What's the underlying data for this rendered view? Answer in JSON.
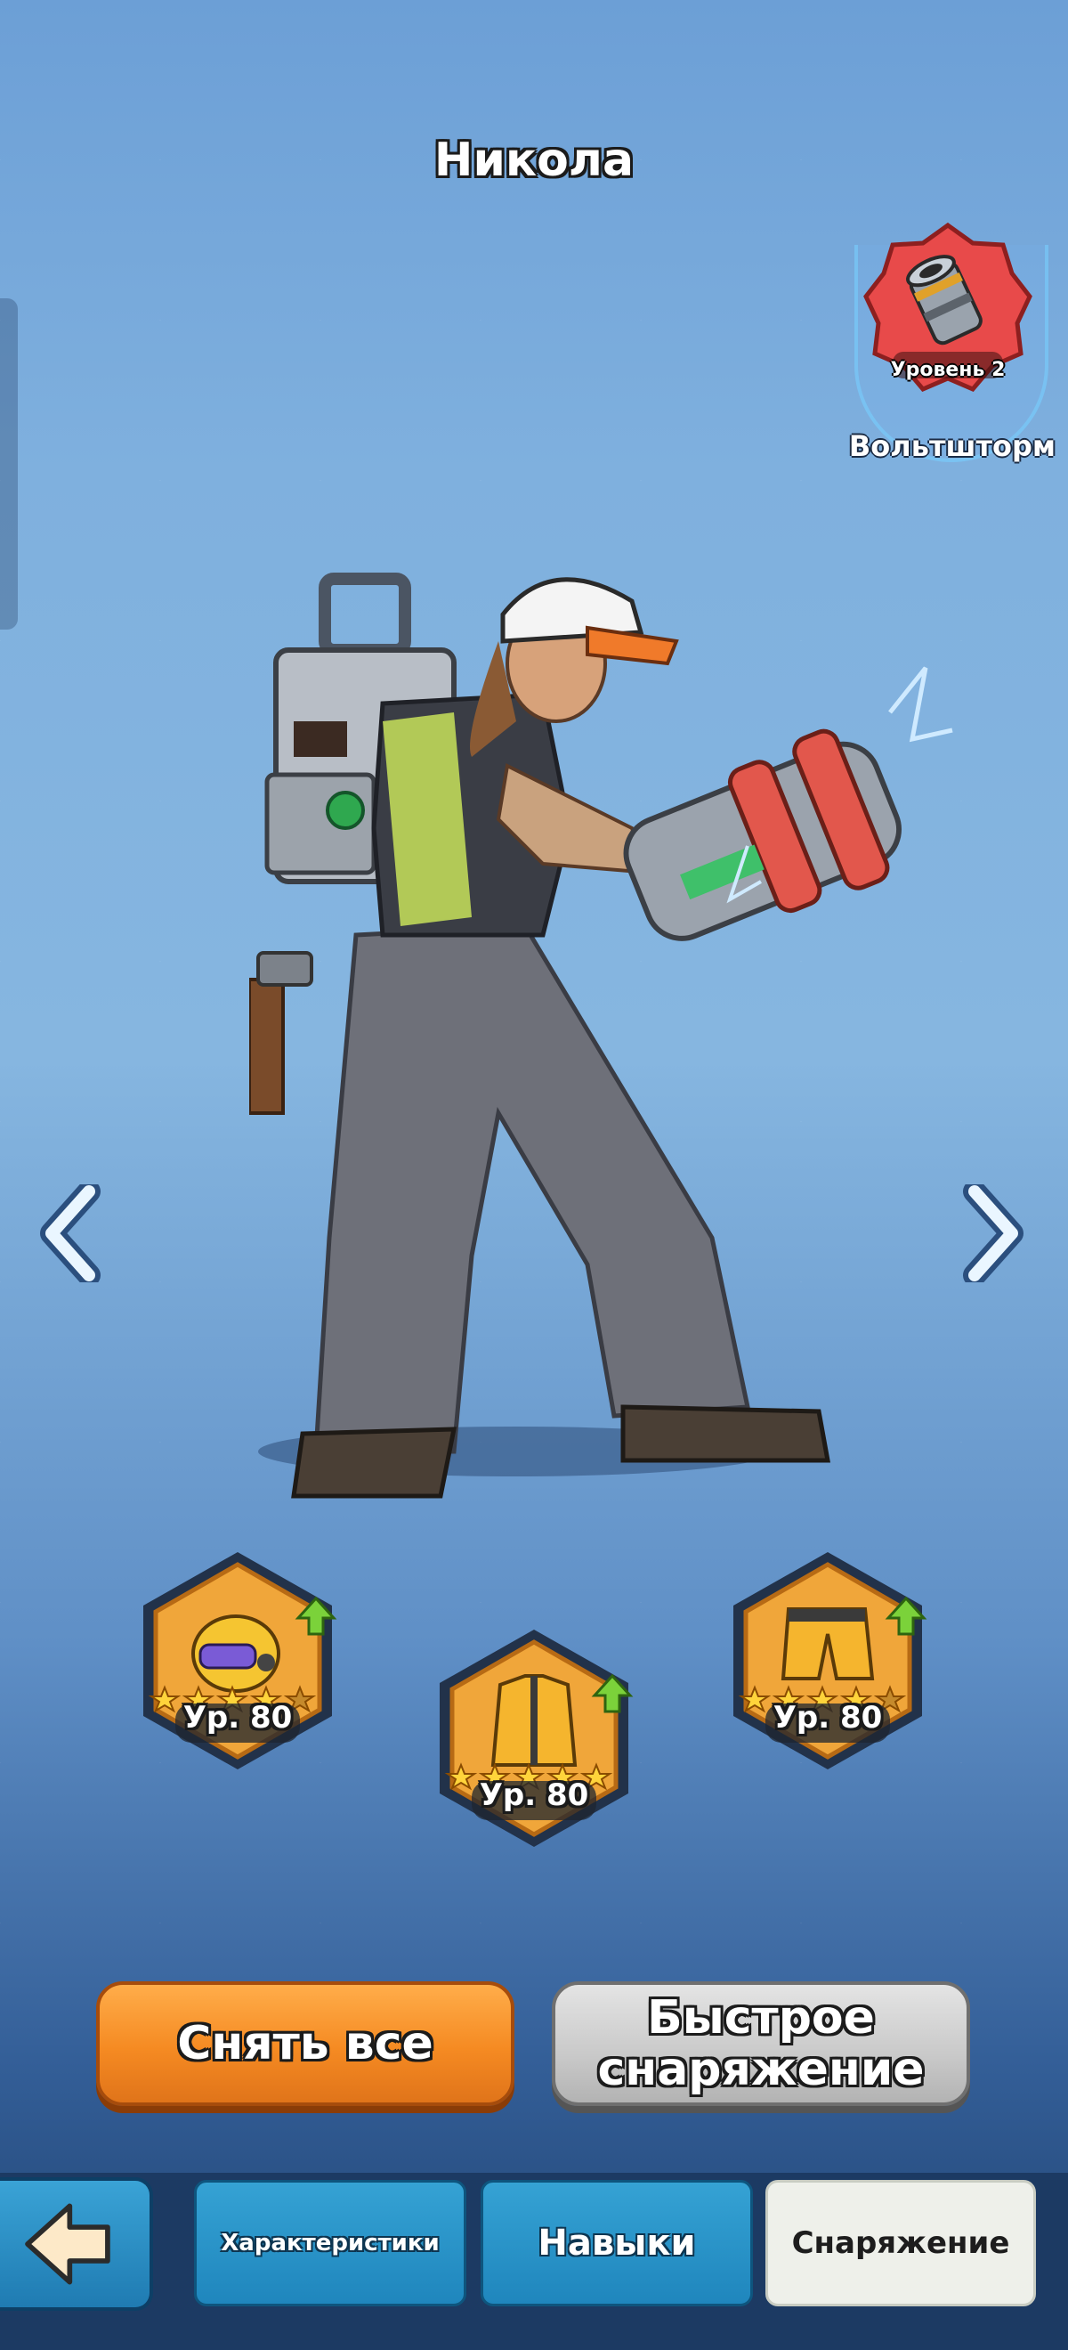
{
  "hero": {
    "name": "Никола"
  },
  "weapon": {
    "level_label": "Уровень 2",
    "name": "Вольтшторм",
    "badge_color": "#e84a4a"
  },
  "equipment": [
    {
      "slot": "helmet",
      "level_label": "Ур. 80",
      "stars": 4
    },
    {
      "slot": "armor",
      "level_label": "Ур. 80",
      "stars": 5
    },
    {
      "slot": "pants",
      "level_label": "Ур. 80",
      "stars": 4
    }
  ],
  "buttons": {
    "remove_all": "Снять все",
    "quick_equip": "Быстрое снаряжение"
  },
  "tabs": [
    {
      "label": "Характеристики",
      "active": false
    },
    {
      "label": "Навыки",
      "active": false
    },
    {
      "label": "Снаряжение",
      "active": true
    }
  ],
  "colors": {
    "accent_orange": "#f58a22",
    "tab_blue": "#1f86bd",
    "upgrade_green": "#7bd23a"
  }
}
